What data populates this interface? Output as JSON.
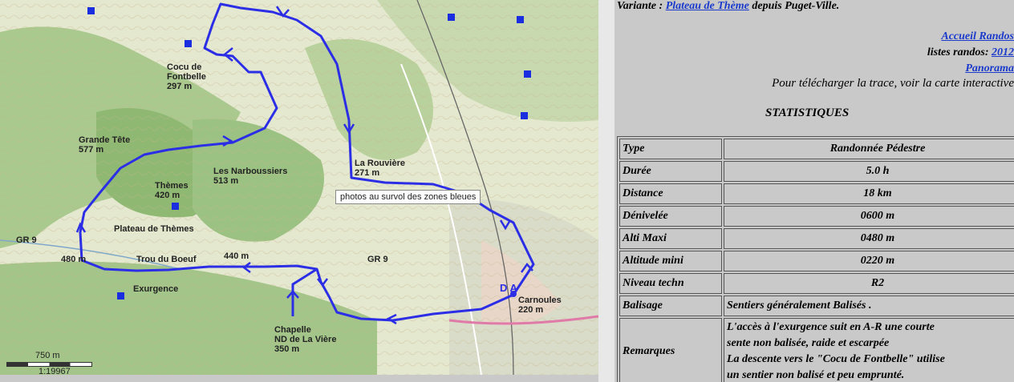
{
  "map": {
    "tooltip": "photos au survol des zones bleues",
    "scale": "750 m",
    "scale_ratio": "1:19967",
    "labels": [
      {
        "name": "cocu",
        "lines": [
          "Cocu de",
          "Fontbelle",
          "297 m"
        ]
      },
      {
        "name": "grande-tete",
        "lines": [
          "Grande Tête",
          "577 m"
        ]
      },
      {
        "name": "themes",
        "lines": [
          "Thèmes",
          "420 m"
        ]
      },
      {
        "name": "narboussiers",
        "lines": [
          "Les Narboussiers",
          "513 m"
        ]
      },
      {
        "name": "rouviere",
        "lines": [
          "La Rouvière",
          "271 m"
        ]
      },
      {
        "name": "plateau",
        "lines": [
          "Plateau de Thèmes"
        ]
      },
      {
        "name": "gr9-left",
        "lines": [
          "GR 9"
        ]
      },
      {
        "name": "alt-480",
        "lines": [
          "480 m"
        ]
      },
      {
        "name": "trou",
        "lines": [
          "Trou du Boeuf"
        ]
      },
      {
        "name": "alt-440",
        "lines": [
          "440 m"
        ]
      },
      {
        "name": "gr9-right",
        "lines": [
          "GR 9"
        ]
      },
      {
        "name": "exurgence",
        "lines": [
          "Exurgence"
        ]
      },
      {
        "name": "chapelle",
        "lines": [
          "Chapelle",
          "ND de La Vière",
          "350 m"
        ]
      },
      {
        "name": "carnoules",
        "lines": [
          "Carnoules",
          "220 m"
        ]
      },
      {
        "name": "da",
        "lines": [
          "D  A"
        ]
      }
    ],
    "route_color": "#2c2ee6",
    "marker_color": "#1a2ee0"
  },
  "variante": {
    "prefix": "Variante :",
    "link": "Plateau de Thème",
    "suffix": "depuis Puget-Ville."
  },
  "links": {
    "accueil": "Accueil Randos",
    "listes_prefix": "listes randos:",
    "listes_link": "2012",
    "panorama": "Panorama"
  },
  "download_text": "Pour télécharger la trace, voir la carte interactive",
  "stats_title": "STATISTIQUES",
  "stats": [
    {
      "key": "Type",
      "value": "Randonnée Pédestre",
      "align": "v"
    },
    {
      "key": "Durée",
      "value": "5.0 h",
      "align": "v"
    },
    {
      "key": "Distance",
      "value": "18 km",
      "align": "v"
    },
    {
      "key": "Dénivelée",
      "value": "0600 m",
      "align": "v"
    },
    {
      "key": "Alti Maxi",
      "value": "0480 m",
      "align": "v"
    },
    {
      "key": "Altitude mini",
      "value": "0220 m",
      "align": "v"
    },
    {
      "key": "Niveau techn",
      "value": "R2",
      "align": "v"
    },
    {
      "key": "Balisage",
      "value": "Sentiers généralement Balisés .",
      "align": "l"
    }
  ],
  "remarques": {
    "key": "Remarques",
    "lines": [
      "L'accès à l'exurgence suit en A-R une courte",
      "sente non balisée, raide et escarpée",
      "La descente vers le \"Cocu de Fontbelle\" utilise",
      "un sentier non balisé et peu emprunté."
    ]
  }
}
